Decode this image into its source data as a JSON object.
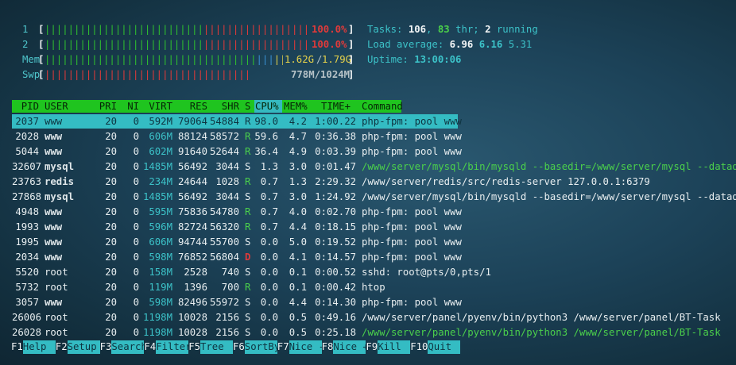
{
  "meters": {
    "cpu1": {
      "label": "1",
      "value": "100.0%",
      "fill": 1.0
    },
    "cpu2": {
      "label": "2",
      "value": "100.0%",
      "fill": 1.0
    },
    "mem": {
      "label": "Mem",
      "value_used": "1.62G",
      "sep": "/",
      "value_total": "1.79G",
      "fill": 0.9
    },
    "swp": {
      "label": "Swp",
      "value": "778M/1024M",
      "fill": 0.76
    }
  },
  "summary": {
    "tasks_label": "Tasks: ",
    "tasks_count": "106",
    "sep1": ", ",
    "thr_count": "83",
    "thr_label": " thr; ",
    "running_count": "2",
    "running_label": " running",
    "load_label": "Load average: ",
    "load1": "6.96",
    "load5": "6.16",
    "load15": "5.31",
    "uptime_label": "Uptime: ",
    "uptime_value": "13:00:06"
  },
  "columns": [
    "PID",
    "USER",
    "PRI",
    "NI",
    "VIRT",
    "RES",
    "SHR",
    "S",
    "CPU%",
    "MEM%",
    "TIME+",
    "Command"
  ],
  "processes": [
    {
      "pid": "2037",
      "user": "www",
      "pri": "20",
      "ni": "0",
      "virt": "592M",
      "res": "79064",
      "shr": "54884",
      "s": "R",
      "cpu": "98.0",
      "mem": "4.2",
      "time": "1:00.22",
      "cmd": "php-fpm: pool www",
      "selected": true
    },
    {
      "pid": "2028",
      "user": "www",
      "pri": "20",
      "ni": "0",
      "virt": "606M",
      "res": "88124",
      "shr": "58572",
      "s": "R",
      "cpu": "59.6",
      "mem": "4.7",
      "time": "0:36.38",
      "cmd": "php-fpm: pool www"
    },
    {
      "pid": "5044",
      "user": "www",
      "pri": "20",
      "ni": "0",
      "virt": "602M",
      "res": "91640",
      "shr": "52644",
      "s": "R",
      "cpu": "36.4",
      "mem": "4.9",
      "time": "0:03.39",
      "cmd": "php-fpm: pool www"
    },
    {
      "pid": "32607",
      "user": "mysql",
      "pri": "20",
      "ni": "0",
      "virt": "1485M",
      "res": "56492",
      "shr": "3044",
      "s": "S",
      "cpu": "1.3",
      "mem": "3.0",
      "time": "0:01.47",
      "cmd": "/www/server/mysql/bin/mysqld --basedir=/www/server/mysql --datadi",
      "thread": true
    },
    {
      "pid": "23763",
      "user": "redis",
      "pri": "20",
      "ni": "0",
      "virt": "234M",
      "res": "24644",
      "shr": "1028",
      "s": "R",
      "cpu": "0.7",
      "mem": "1.3",
      "time": "2:29.32",
      "cmd": "/www/server/redis/src/redis-server 127.0.0.1:6379"
    },
    {
      "pid": "27868",
      "user": "mysql",
      "pri": "20",
      "ni": "0",
      "virt": "1485M",
      "res": "56492",
      "shr": "3044",
      "s": "S",
      "cpu": "0.7",
      "mem": "3.0",
      "time": "1:24.92",
      "cmd": "/www/server/mysql/bin/mysqld --basedir=/www/server/mysql --datadi"
    },
    {
      "pid": "4948",
      "user": "www",
      "pri": "20",
      "ni": "0",
      "virt": "595M",
      "res": "75836",
      "shr": "54780",
      "s": "R",
      "cpu": "0.7",
      "mem": "4.0",
      "time": "0:02.70",
      "cmd": "php-fpm: pool www"
    },
    {
      "pid": "1993",
      "user": "www",
      "pri": "20",
      "ni": "0",
      "virt": "596M",
      "res": "82724",
      "shr": "56320",
      "s": "R",
      "cpu": "0.7",
      "mem": "4.4",
      "time": "0:18.15",
      "cmd": "php-fpm: pool www"
    },
    {
      "pid": "1995",
      "user": "www",
      "pri": "20",
      "ni": "0",
      "virt": "606M",
      "res": "94744",
      "shr": "55700",
      "s": "S",
      "cpu": "0.0",
      "mem": "5.0",
      "time": "0:19.52",
      "cmd": "php-fpm: pool www"
    },
    {
      "pid": "2034",
      "user": "www",
      "pri": "20",
      "ni": "0",
      "virt": "598M",
      "res": "76852",
      "shr": "56804",
      "s": "D",
      "cpu": "0.0",
      "mem": "4.1",
      "time": "0:14.57",
      "cmd": "php-fpm: pool www"
    },
    {
      "pid": "5520",
      "user": "root",
      "pri": "20",
      "ni": "0",
      "virt": "158M",
      "res": "2528",
      "shr": "740",
      "s": "S",
      "cpu": "0.0",
      "mem": "0.1",
      "time": "0:00.52",
      "cmd": "sshd: root@pts/0,pts/1"
    },
    {
      "pid": "5732",
      "user": "root",
      "pri": "20",
      "ni": "0",
      "virt": "119M",
      "res": "1396",
      "shr": "700",
      "s": "R",
      "cpu": "0.0",
      "mem": "0.1",
      "time": "0:00.42",
      "cmd": "htop"
    },
    {
      "pid": "3057",
      "user": "www",
      "pri": "20",
      "ni": "0",
      "virt": "598M",
      "res": "82496",
      "shr": "55972",
      "s": "S",
      "cpu": "0.0",
      "mem": "4.4",
      "time": "0:14.30",
      "cmd": "php-fpm: pool www"
    },
    {
      "pid": "26006",
      "user": "root",
      "pri": "20",
      "ni": "0",
      "virt": "1198M",
      "res": "10028",
      "shr": "2156",
      "s": "S",
      "cpu": "0.0",
      "mem": "0.5",
      "time": "0:49.16",
      "cmd": "/www/server/panel/pyenv/bin/python3 /www/server/panel/BT-Task"
    },
    {
      "pid": "26028",
      "user": "root",
      "pri": "20",
      "ni": "0",
      "virt": "1198M",
      "res": "10028",
      "shr": "2156",
      "s": "S",
      "cpu": "0.0",
      "mem": "0.5",
      "time": "0:25.18",
      "cmd": "/www/server/panel/pyenv/bin/python3 /www/server/panel/BT-Task",
      "thread": true
    }
  ],
  "footer": [
    {
      "key": "F1",
      "label": "Help  "
    },
    {
      "key": "F2",
      "label": "Setup "
    },
    {
      "key": "F3",
      "label": "Search"
    },
    {
      "key": "F4",
      "label": "Filter"
    },
    {
      "key": "F5",
      "label": "Tree  "
    },
    {
      "key": "F6",
      "label": "SortBy"
    },
    {
      "key": "F7",
      "label": "Nice -"
    },
    {
      "key": "F8",
      "label": "Nice +"
    },
    {
      "key": "F9",
      "label": "Kill  "
    },
    {
      "key": "F10",
      "label": "Quit  "
    }
  ],
  "colors": {
    "header_bg": "#1fc41f",
    "sort_col_bg": "#35b9c0",
    "selected_bg": "#34bcc3",
    "meter_green": "#2fbf2f",
    "meter_red": "#e03a3a"
  }
}
